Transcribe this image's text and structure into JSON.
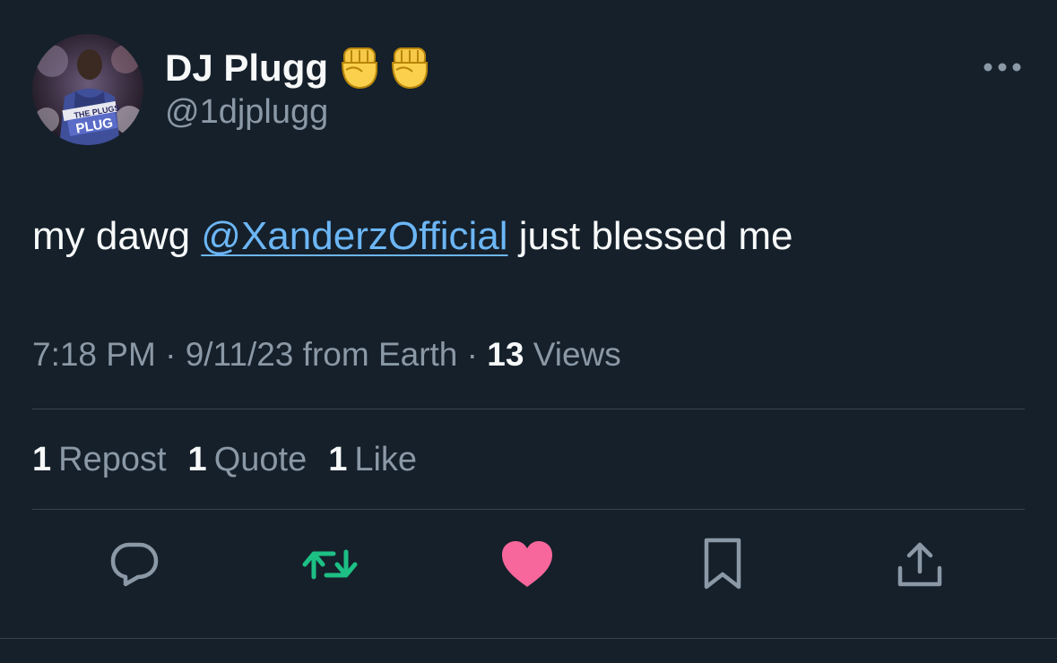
{
  "author": {
    "display_name": "DJ Plugg",
    "handle": "@1djplugg",
    "avatar_text_top": "THE PLUGS",
    "avatar_text_bottom": "PLUG",
    "name_emojis": [
      "raised-fist-emoji",
      "raised-fist-emoji"
    ]
  },
  "tweet": {
    "text_before": "my dawg ",
    "mention": "@XanderzOfficial",
    "text_after": " just blessed me"
  },
  "meta": {
    "time": "7:18 PM",
    "date": "9/11/23",
    "source": "from Earth",
    "separator": "·",
    "views_count": "13",
    "views_label": "Views"
  },
  "stats": [
    {
      "count": "1",
      "label": "Repost"
    },
    {
      "count": "1",
      "label": "Quote"
    },
    {
      "count": "1",
      "label": "Like"
    }
  ],
  "actions": [
    {
      "icon": "reply-icon",
      "color": "#8b98a5"
    },
    {
      "icon": "repost-icon",
      "color": "#00ba7c"
    },
    {
      "icon": "heart-icon",
      "color": "#f91880"
    },
    {
      "icon": "bookmark-icon",
      "color": "#8b98a5"
    },
    {
      "icon": "share-icon",
      "color": "#8b98a5"
    }
  ],
  "colors": {
    "background": "#15202b",
    "text": "#f7f9f9",
    "secondary": "#8b98a5",
    "link": "#6cb6f5",
    "divider": "#38444d",
    "repost_active": "#00ba7c",
    "like_active": "#f7679b"
  }
}
